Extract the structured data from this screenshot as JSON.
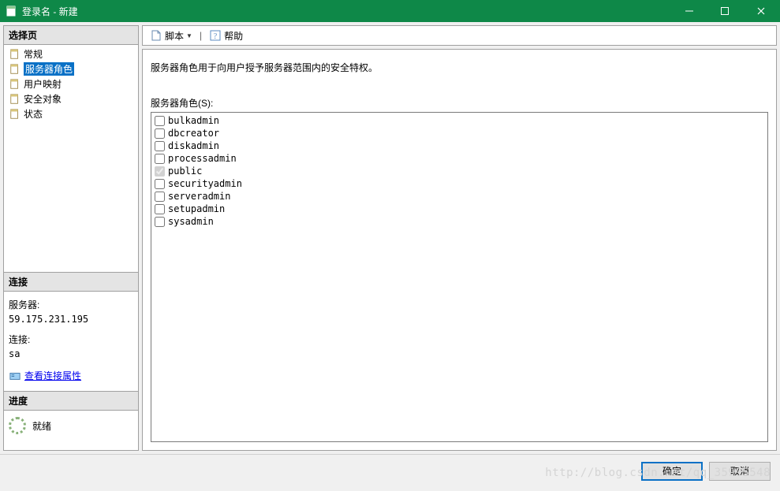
{
  "titlebar": {
    "title": "登录名 - 新建"
  },
  "left": {
    "select_page_header": "选择页",
    "nav": [
      {
        "label": "常规"
      },
      {
        "label": "服务器角色"
      },
      {
        "label": "用户映射"
      },
      {
        "label": "安全对象"
      },
      {
        "label": "状态"
      }
    ],
    "connection_header": "连接",
    "server_label": "服务器:",
    "server_value": "59.175.231.195",
    "conn_label": "连接:",
    "conn_value": "sa",
    "view_props_link": "查看连接属性",
    "progress_header": "进度",
    "progress_status": "就绪"
  },
  "toolbar": {
    "script": "脚本",
    "help": "帮助"
  },
  "main": {
    "description": "服务器角色用于向用户授予服务器范围内的安全特权。",
    "list_label": "服务器角色(S):",
    "roles": [
      {
        "name": "bulkadmin",
        "checked": false
      },
      {
        "name": "dbcreator",
        "checked": false
      },
      {
        "name": "diskadmin",
        "checked": false
      },
      {
        "name": "processadmin",
        "checked": false
      },
      {
        "name": "public",
        "checked": true
      },
      {
        "name": "securityadmin",
        "checked": false
      },
      {
        "name": "serveradmin",
        "checked": false
      },
      {
        "name": "setupadmin",
        "checked": false
      },
      {
        "name": "sysadmin",
        "checked": false
      }
    ]
  },
  "footer": {
    "ok": "确定",
    "cancel": "取消",
    "watermark": "http://blog.csdn.net/qq_35995548"
  }
}
